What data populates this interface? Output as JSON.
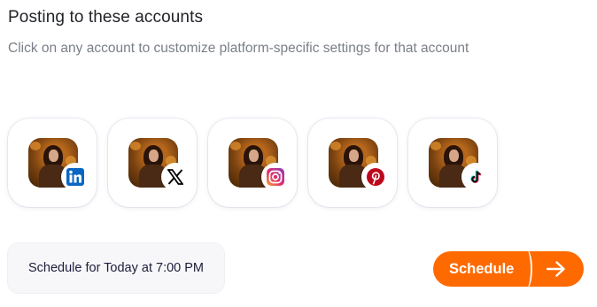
{
  "header": {
    "title": "Posting to these accounts",
    "subtitle": "Click on any account to customize platform-specific settings for that account"
  },
  "accounts": [
    {
      "platform": "linkedin",
      "icon": "linkedin-icon",
      "color": "#0a66c2"
    },
    {
      "platform": "x",
      "icon": "x-icon",
      "color": "#000000"
    },
    {
      "platform": "instagram",
      "icon": "instagram-icon",
      "color": "#e1306c"
    },
    {
      "platform": "pinterest",
      "icon": "pinterest-icon",
      "color": "#bd081c"
    },
    {
      "platform": "tiktok",
      "icon": "tiktok-icon",
      "color": "#000000"
    }
  ],
  "footer": {
    "schedule_text": "Schedule for Today at 7:00 PM",
    "schedule_button": "Schedule",
    "button_icon": "arrow-right-icon",
    "accent_color": "#ff6a00"
  }
}
